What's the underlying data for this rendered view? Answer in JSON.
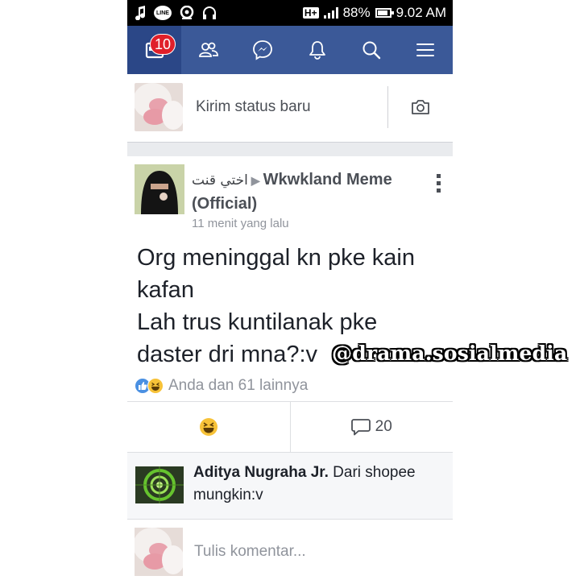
{
  "statusbar": {
    "left_icons": [
      "music-note-icon",
      "line-app-icon",
      "location-icon",
      "headset-icon"
    ],
    "line_label": "LINE",
    "network": "H+",
    "battery": "88%",
    "time": "9.02 AM"
  },
  "navbar": {
    "tabs": [
      {
        "icon": "news-feed-icon",
        "active": true
      },
      {
        "icon": "friends-icon"
      },
      {
        "icon": "messenger-icon"
      },
      {
        "icon": "bell-icon"
      },
      {
        "icon": "search-icon"
      },
      {
        "icon": "menu-icon"
      }
    ],
    "news_badge": "10",
    "colors": {
      "bar": "#3b5998",
      "active": "#2b4787",
      "badge": "#e0202a"
    }
  },
  "composer": {
    "placeholder": "Kirim status baru",
    "camera_icon": "camera-icon"
  },
  "post": {
    "author_arabic": "اختي قنت",
    "group": "Wkwkland Meme (Official)",
    "time": "11 menit yang lalu",
    "body": "Org meninggal kn pke kain\nkafan\nLah trus kuntilanak pke\ndaster dri mna?:v",
    "reactions_text": "Anda dan 61 lainnya",
    "reaction_icons": [
      "like-icon",
      "haha-icon"
    ],
    "comment_count": "20"
  },
  "comment": {
    "author": "Aditya Nugraha Jr.",
    "text": "Dari shopee mungkin:v"
  },
  "write_comment": {
    "placeholder": "Tulis komentar..."
  },
  "watermark": "@drama.sosialmedia"
}
